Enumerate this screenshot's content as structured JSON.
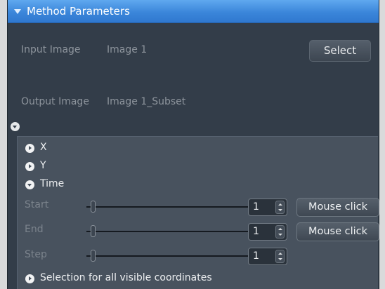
{
  "header": {
    "title": "Method Parameters"
  },
  "input": {
    "label": "Input Image",
    "value": "Image 1",
    "button_label": "Select"
  },
  "output": {
    "label": "Output Image",
    "value": "Image 1_Subset"
  },
  "dimensions": [
    {
      "label": "X",
      "expanded": false
    },
    {
      "label": "Y",
      "expanded": false
    },
    {
      "label": "Time",
      "expanded": true
    }
  ],
  "time": {
    "start": {
      "label": "Start",
      "value": "1",
      "button_label": "Mouse click"
    },
    "end": {
      "label": "End",
      "value": "1",
      "button_label": "Mouse click"
    },
    "step": {
      "label": "Step",
      "value": "1"
    }
  },
  "selection_all": {
    "label": "Selection for all visible coordinates"
  }
}
